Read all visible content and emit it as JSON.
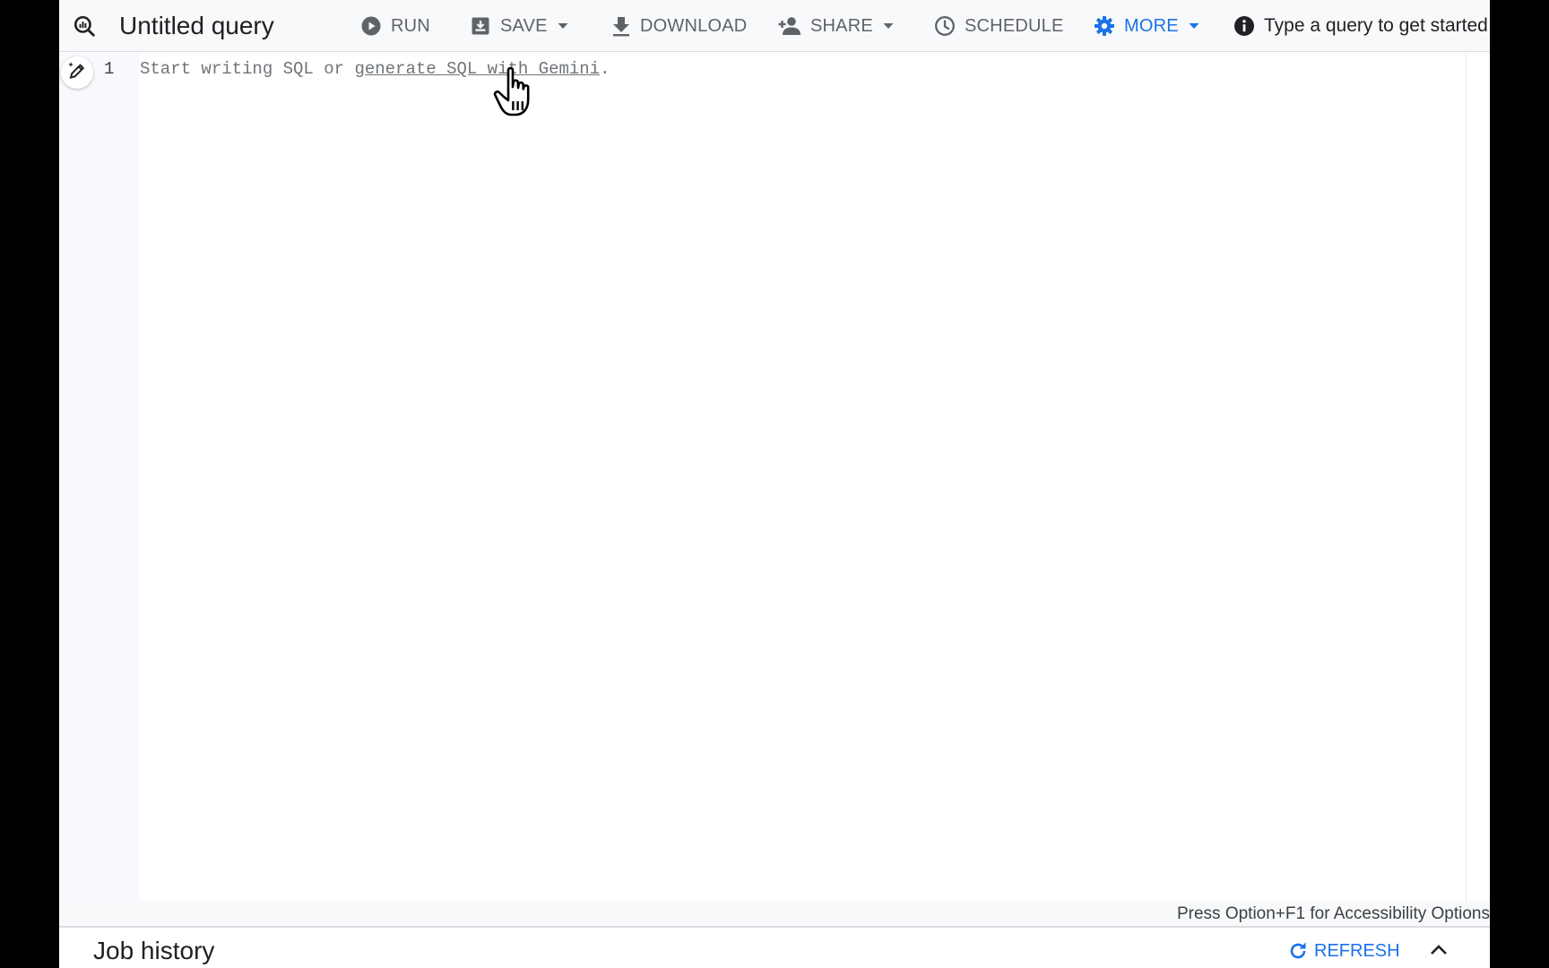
{
  "toolbar": {
    "title": "Untitled query",
    "run_label": "RUN",
    "save_label": "SAVE",
    "download_label": "DOWNLOAD",
    "share_label": "SHARE",
    "schedule_label": "SCHEDULE",
    "more_label": "MORE",
    "status_text": "Type a query to get started",
    "icons": {
      "logo": "bigquery-logo-icon",
      "run": "play-circle-icon",
      "save": "save-download-icon",
      "download": "download-icon",
      "share": "person-add-icon",
      "schedule": "clock-icon",
      "more": "gear-icon",
      "status": "info-icon"
    }
  },
  "editor": {
    "line_number": "1",
    "placeholder_prefix": "Start writing SQL or ",
    "placeholder_link": "generate SQL with Gemini",
    "placeholder_suffix": ".",
    "ai_button_icon": "pen-sparkle-icon"
  },
  "accessibility_hint": "Press Option+F1 for Accessibility Options",
  "job_history": {
    "title": "Job history",
    "refresh_label": "REFRESH",
    "refresh_icon": "refresh-icon",
    "collapse_icon": "chevron-up-icon"
  },
  "colors": {
    "accent": "#1a73e8",
    "muted_text": "#5f6368",
    "toolbar_bg": "#f8f9fa"
  }
}
